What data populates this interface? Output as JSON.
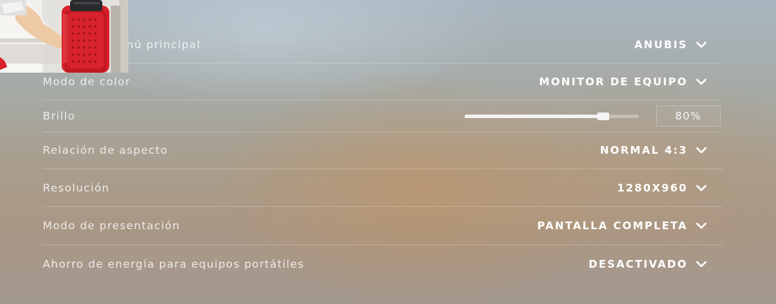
{
  "settings": {
    "rows": [
      {
        "label": "Fondo del menú principal",
        "value": "ANUBIS",
        "icon": "chevron-down-icon"
      },
      {
        "label": "Modo de color",
        "value": "MONITOR DE EQUIPO",
        "icon": "chevron-down-icon"
      },
      {
        "label": "Brillo",
        "slider_fraction": 0.8,
        "value": "80%"
      },
      {
        "label": "Relación de aspecto",
        "value": "NORMAL 4:3",
        "icon": "chevron-down-icon"
      },
      {
        "label": "Resolución",
        "value": "1280X960",
        "icon": "chevron-down-icon"
      },
      {
        "label": "Modo de presentación",
        "value": "PANTALLA COMPLETA",
        "icon": "chevron-down-icon"
      },
      {
        "label": "Ahorro de energía para equipos portátiles",
        "value": "DESACTIVADO",
        "icon": "chevron-down-icon"
      }
    ]
  },
  "colors": {
    "text": "#f6f6f6",
    "value_text": "#ffffff",
    "divider": "#ebebeb",
    "webcam_mic": "#d8202a"
  }
}
